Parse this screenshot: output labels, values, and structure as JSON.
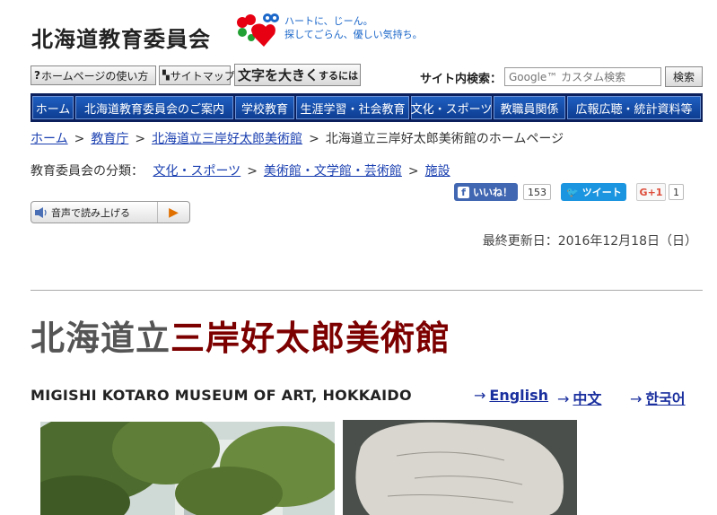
{
  "header": {
    "site_title": "北海道教育委員会",
    "tagline_line1": "ハートに、じーん。",
    "tagline_line2": "探してごらん、優しい気持ち。"
  },
  "utility": {
    "howto_label": "ホームページの使い方",
    "sitemap_label": "サイトマップ",
    "fontsize_big": "文字を大きく",
    "fontsize_small": "するには",
    "search_label": "サイト内検索：",
    "search_placeholder": "Google™ カスタム検索",
    "search_button": "検索"
  },
  "gnav": [
    "ホーム",
    "北海道教育委員会のご案内",
    "学校教育",
    "生涯学習・社会教育",
    "文化・スポーツ",
    "教職員関係",
    "広報広聴・統計資料等"
  ],
  "breadcrumb": {
    "home": "ホーム",
    "agency": "教育庁",
    "museum": "北海道立三岸好太郎美術館",
    "current": "北海道立三岸好太郎美術館のホームページ",
    "separator": ">"
  },
  "category": {
    "label": "教育委員会の分類：",
    "culture": "文化・スポーツ",
    "museums": "美術館・文学館・芸術館",
    "facilities": "施設"
  },
  "social": {
    "fb_label": "いいね！",
    "fb_count": "153",
    "tw_label": "ツイート",
    "gp_label": "G+1",
    "gp_count": "1"
  },
  "readaloud": {
    "label": "音声で読み上げる"
  },
  "updated": "最終更新日：2016年12月18日（日）",
  "museum": {
    "title_prefix": "北海道立",
    "title_main": "三岸好太郎美術館",
    "en_title": "MIGISHI KOTARO MUSEUM OF ART, HOKKAIDO",
    "arrow": "→",
    "lang_en": "English",
    "lang_zh": "中文",
    "lang_ko": "한국어"
  },
  "colors": {
    "nav_bg": "#0a1f5c",
    "nav_item": "#1f5fc0",
    "title_accent": "#7d0000",
    "link": "#1a3fb0"
  }
}
